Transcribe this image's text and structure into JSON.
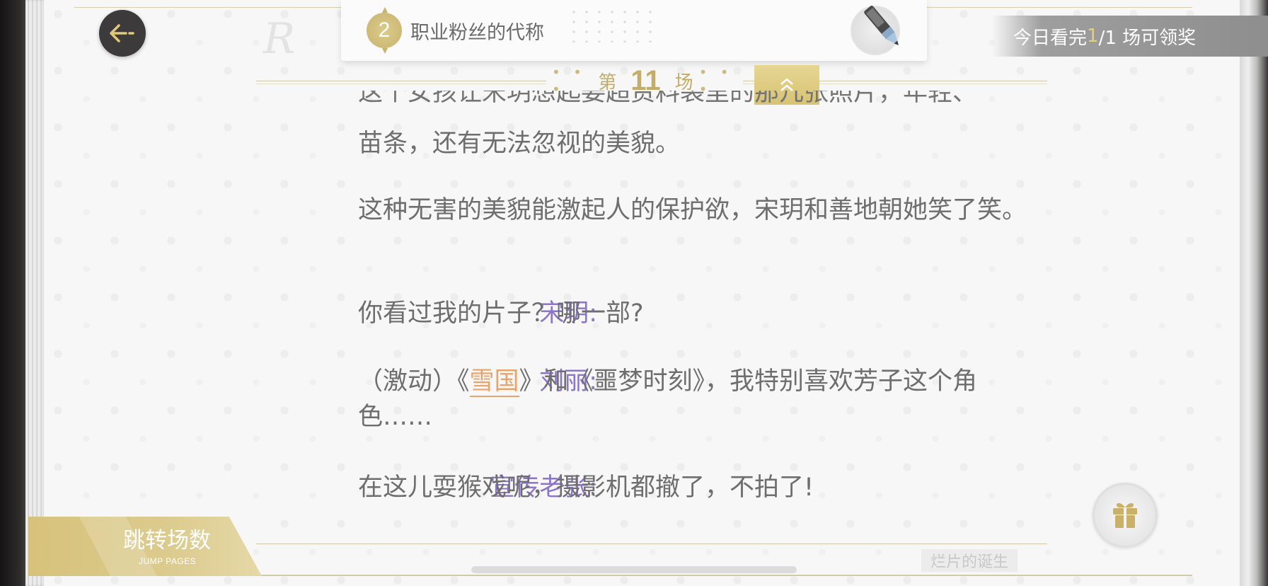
{
  "header": {
    "chapter_number": "2",
    "chapter_title": "职业粉丝的代称",
    "reward_prefix": "今日看完 ",
    "reward_count": "1",
    "reward_suffix": "/1 场可领奖"
  },
  "scene": {
    "dots_left": "• • •",
    "label_prefix": "第",
    "number": "11",
    "label_suffix": "场",
    "dots_right": "• • •"
  },
  "content": {
    "para1_cut": "这个女孩让宋玥想起姜超资料袋里的那几张照片，年轻、",
    "para1_end": "苗条，还有无法忽视的美貌。",
    "para2": "这种无害的美貌能激起人的保护欲，宋玥和善地朝她笑了笑。",
    "dialogs": [
      {
        "speaker": "宋玥:",
        "line": "你看过我的片子？哪一部?"
      },
      {
        "speaker": "刘丽:",
        "line_before": "（激动）《",
        "highlight": "雪国",
        "line_after": "》和《噩梦时刻》，我特别喜欢芳子这个角色……"
      },
      {
        "speaker": "宣传老张:",
        "line": "在这儿耍猴戏呢，摄影机都撤了，不拍了!"
      }
    ]
  },
  "footer": {
    "jump_title": "跳转场数",
    "jump_subtitle": "JUMP PAGES",
    "book_title": "烂片的诞生"
  },
  "icons": {
    "back": "arrow-left-icon",
    "pen": "pen-icon",
    "collapse": "chevron-up-icon",
    "gift": "gift-icon"
  },
  "colors": {
    "accent_gold": "#c4ad66",
    "speaker_purple": "#8b76c7",
    "highlight_orange": "#e9a46a",
    "body_text": "#6e6e6e"
  }
}
